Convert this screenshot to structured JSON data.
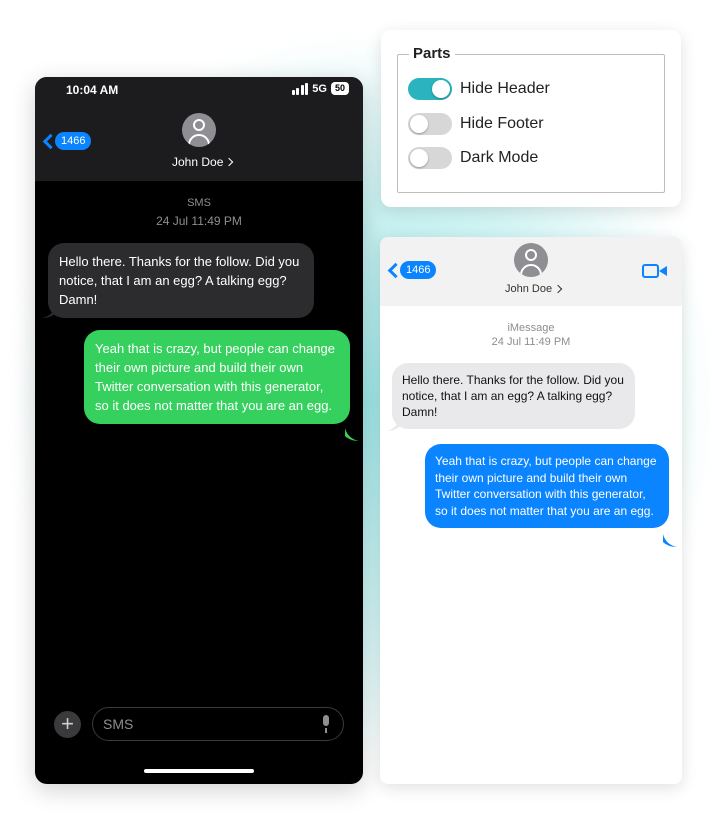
{
  "dark_phone": {
    "status_time": "10:04 AM",
    "network": "5G",
    "battery": "50",
    "back_count": "1466",
    "contact_name": "John Doe",
    "service": "SMS",
    "date": "24 Jul 11:49 PM",
    "incoming_message": "Hello there. Thanks for the follow. Did you notice, that I am an egg? A talking egg? Damn!",
    "outgoing_message": "Yeah that is crazy, but people can change their own picture and build their own Twitter conversation with this generator, so it does not matter that you are an egg.",
    "input_placeholder": "SMS",
    "colors": {
      "outgoing_bubble": "#35d05e",
      "incoming_bubble": "#2c2c2e",
      "accent": "#0a84ff"
    }
  },
  "parts_panel": {
    "legend": "Parts",
    "toggles": [
      {
        "label": "Hide Header",
        "on": true
      },
      {
        "label": "Hide Footer",
        "on": false
      },
      {
        "label": "Dark Mode",
        "on": false
      }
    ],
    "colors": {
      "toggle_on": "#2bb3c0",
      "toggle_off": "#d7d7d7"
    }
  },
  "light_phone": {
    "back_count": "1466",
    "contact_name": "John Doe",
    "service": "iMessage",
    "date": "24 Jul 11:49 PM",
    "incoming_message": "Hello there. Thanks for the follow. Did you notice, that I am an egg? A talking egg? Damn!",
    "outgoing_message": "Yeah that is crazy, but people can change their own picture and build their own Twitter conversation with this generator, so it does not matter that you are an egg.",
    "colors": {
      "outgoing_bubble": "#0a84ff",
      "incoming_bubble": "#e9e9eb"
    }
  }
}
